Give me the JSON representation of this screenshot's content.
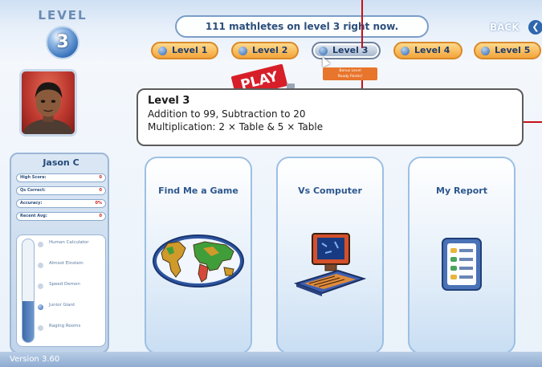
{
  "header": {
    "level_word": "LEVEL",
    "level_number": "3",
    "status": "111 mathletes on level 3 right now.",
    "back_label": "BACK",
    "back_icon": "chevron-left-icon"
  },
  "level_tabs": [
    {
      "label": "Level 1",
      "active": false
    },
    {
      "label": "Level 2",
      "active": false
    },
    {
      "label": "Level 3",
      "active": true
    },
    {
      "label": "Level 4",
      "active": false
    },
    {
      "label": "Level 5",
      "active": false
    }
  ],
  "tooltip": {
    "line1": "Bonus Level",
    "line2": "Ready Points!"
  },
  "play_sign": "PLAY",
  "level_info": {
    "title": "Level 3",
    "line1": "Addition to 99, Subtraction to 20",
    "line2": "Multiplication: 2 × Table & 5 × Table"
  },
  "player": {
    "name": "Jason C",
    "stats": [
      {
        "label": "High Score:",
        "value": "0"
      },
      {
        "label": "Qs Correct:",
        "value": "0"
      },
      {
        "label": "Accuracy:",
        "value": "0%"
      },
      {
        "label": "Recent Avg:",
        "value": "0"
      }
    ],
    "ladder": [
      {
        "label": "Human Calculator",
        "current": false
      },
      {
        "label": "Almost Einstein",
        "current": false
      },
      {
        "label": "Speed Demon",
        "current": false
      },
      {
        "label": "Junior Giant",
        "current": true
      },
      {
        "label": "Raging Rooms",
        "current": false
      }
    ],
    "ladder_fill_fraction": 0.4
  },
  "cards": [
    {
      "label": "Find Me a Game",
      "icon": "world-map-icon"
    },
    {
      "label": "Vs Computer",
      "icon": "computer-icon"
    },
    {
      "label": "My Report",
      "icon": "report-icon"
    }
  ],
  "version": "Version 3.60",
  "colors": {
    "accent_orange": "#f3a53b",
    "brand_blue": "#2f67ad",
    "annotation_red": "#c6101a",
    "play_red": "#d71f29"
  }
}
